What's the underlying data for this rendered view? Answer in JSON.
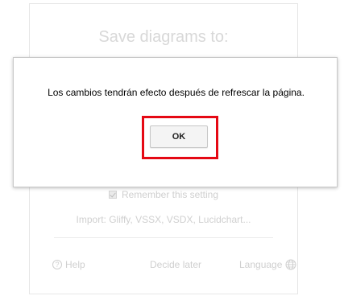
{
  "background_dialog": {
    "title": "Save diagrams to:",
    "remember_setting": "Remember this setting",
    "import_text": "Import: Gliffy, VSSX, VSDX, Lucidchart...",
    "help_label": "Help",
    "help_icon_glyph": "?",
    "decide_later_label": "Decide later",
    "language_label": "Language"
  },
  "modal": {
    "message": "Los cambios tendrán efecto después de refrescar la página.",
    "ok_label": "OK"
  },
  "colors": {
    "highlight": "#e50914",
    "faded_text": "#cfcfcf"
  },
  "icons": {
    "help": "help-circle-icon",
    "language": "globe-icon",
    "remember": "checkbox-checked-icon"
  }
}
